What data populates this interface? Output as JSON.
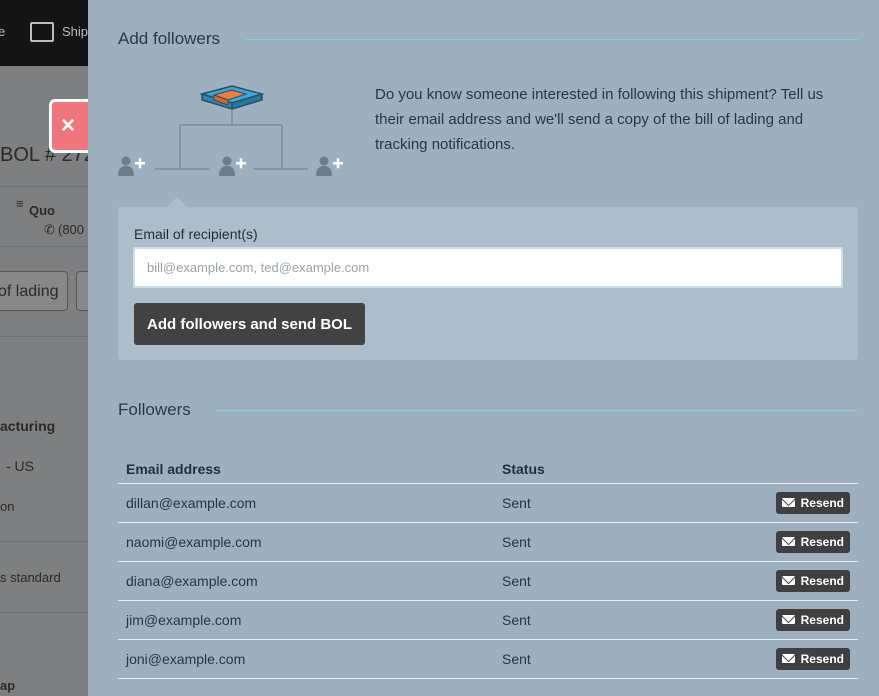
{
  "background": {
    "nav_label_partial_1": "e",
    "nav_label_partial_2": "Ship",
    "bol_title_partial": "BOL # 272",
    "quote_partial": "Quo",
    "phone_partial": "(800",
    "lading_button_partial": "of lading",
    "company_partial": "acturing",
    "country_partial": "- US",
    "misc_partial": "on",
    "service_partial": "s standard",
    "map_partial": "ap"
  },
  "close_button": {
    "label": "×"
  },
  "add_followers": {
    "title": "Add followers",
    "intro": "Do you know someone interested in following this shipment? Tell us their email address and we'll send a copy of the bill of lading and tracking notifications.",
    "email_label": "Email of recipient(s)",
    "email_placeholder": "bill@example.com, ted@example.com",
    "email_value": "",
    "submit_label": "Add followers and send BOL"
  },
  "followers": {
    "title": "Followers",
    "columns": [
      "Email address",
      "Status",
      ""
    ],
    "rows": [
      {
        "email": "dillan@example.com",
        "status": "Sent",
        "action": "Resend"
      },
      {
        "email": "naomi@example.com",
        "status": "Sent",
        "action": "Resend"
      },
      {
        "email": "diana@example.com",
        "status": "Sent",
        "action": "Resend"
      },
      {
        "email": "jim@example.com",
        "status": "Sent",
        "action": "Resend"
      },
      {
        "email": "joni@example.com",
        "status": "Sent",
        "action": "Resend"
      }
    ]
  },
  "colors": {
    "panel_bg": "#9eb0be",
    "form_bg": "#adbdc9",
    "accent_rule": "#7fd0e8",
    "button_dark": "#424242",
    "close_red": "#f0767e",
    "box_blue": "#3aa7d8",
    "box_orange": "#f47b3a"
  }
}
